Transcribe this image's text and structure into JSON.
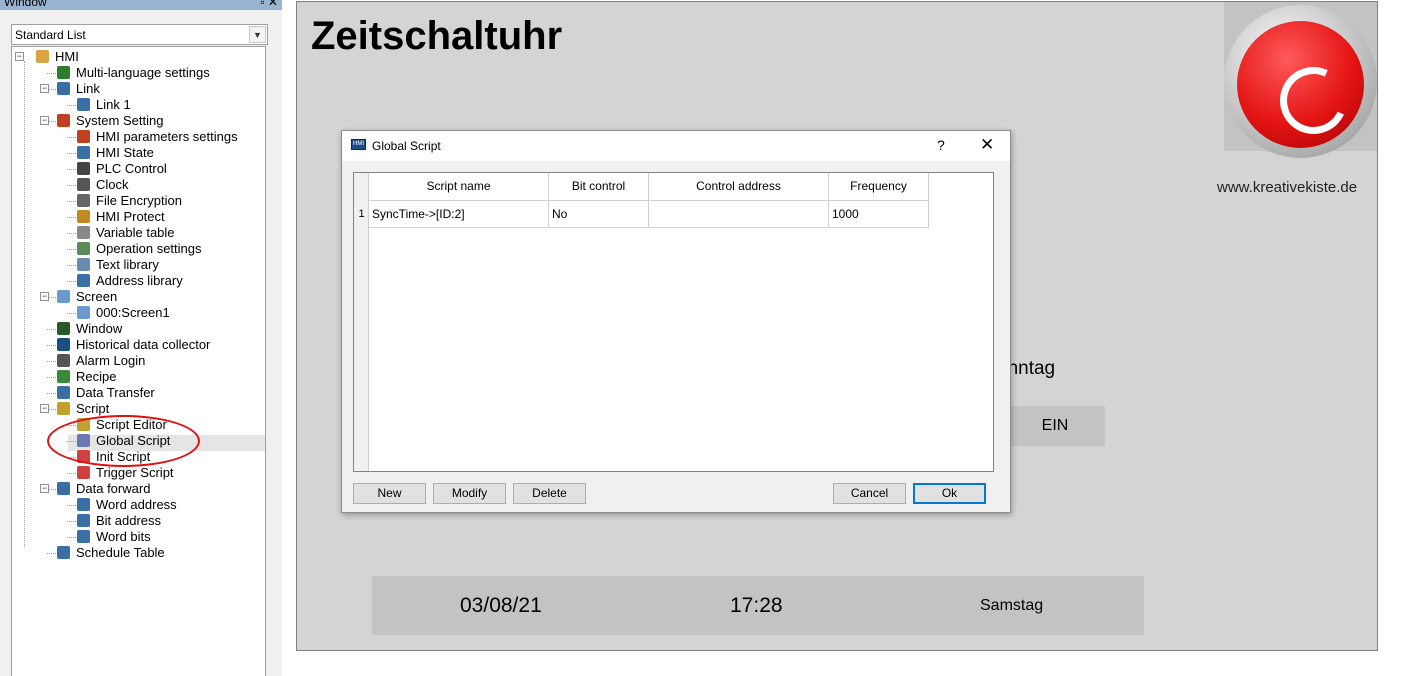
{
  "panel": {
    "title": "Window",
    "title_buttons": "▫ ✕",
    "list_type": "Standard List",
    "tree": [
      {
        "label": "HMI",
        "level": 0,
        "icon": "hmi-icon",
        "color": "#d9a441"
      },
      {
        "label": "Multi-language settings",
        "level": 1,
        "icon": "globe-icon",
        "color": "#2d7d2d"
      },
      {
        "label": "Link",
        "level": 1,
        "icon": "network-icon",
        "color": "#3a6ea5"
      },
      {
        "label": "Link 1",
        "level": 2,
        "icon": "network-node-icon",
        "color": "#3a6ea5"
      },
      {
        "label": "System Setting",
        "level": 1,
        "icon": "tools-icon",
        "color": "#c04020"
      },
      {
        "label": "HMI parameters settings",
        "level": 2,
        "icon": "settings-icon",
        "color": "#c04020"
      },
      {
        "label": "HMI State",
        "level": 2,
        "icon": "state-icon",
        "color": "#3a6ea5"
      },
      {
        "label": "PLC Control",
        "level": 2,
        "icon": "plc-icon",
        "color": "#444444"
      },
      {
        "label": "Clock",
        "level": 2,
        "icon": "clock-icon",
        "color": "#555555"
      },
      {
        "label": "File Encryption",
        "level": 2,
        "icon": "lock-icon",
        "color": "#666666"
      },
      {
        "label": "HMI Protect",
        "level": 2,
        "icon": "key-icon",
        "color": "#c08a20"
      },
      {
        "label": "Variable table",
        "level": 2,
        "icon": "table-icon",
        "color": "#888888"
      },
      {
        "label": "Operation settings",
        "level": 2,
        "icon": "operation-icon",
        "color": "#5a8a5a"
      },
      {
        "label": "Text library",
        "level": 2,
        "icon": "text-library-icon",
        "color": "#6a8ab0"
      },
      {
        "label": "Address library",
        "level": 2,
        "icon": "address-library-icon",
        "color": "#3a6ea5"
      },
      {
        "label": "Screen",
        "level": 1,
        "icon": "screen-icon",
        "color": "#6a9ad0"
      },
      {
        "label": "000:Screen1",
        "level": 2,
        "icon": "screen-page-icon",
        "color": "#6a9ad0"
      },
      {
        "label": "Window",
        "level": 1,
        "icon": "window-icon",
        "color": "#2a5a2a"
      },
      {
        "label": "Historical data collector",
        "level": 1,
        "icon": "save-icon",
        "color": "#1c4e86"
      },
      {
        "label": "Alarm Login",
        "level": 1,
        "icon": "alarm-icon",
        "color": "#555555"
      },
      {
        "label": "Recipe",
        "level": 1,
        "icon": "recipe-icon",
        "color": "#3a8a3a"
      },
      {
        "label": "Data Transfer",
        "level": 1,
        "icon": "data-transfer-icon",
        "color": "#3a6ea5"
      },
      {
        "label": "Script",
        "level": 1,
        "icon": "script-icon",
        "color": "#c0a030"
      },
      {
        "label": "Script Editor",
        "level": 2,
        "icon": "pencil-icon",
        "color": "#c0a030"
      },
      {
        "label": "Global Script",
        "level": 2,
        "icon": "global-script-icon",
        "color": "#6a7ab0"
      },
      {
        "label": "Init Script",
        "level": 2,
        "icon": "init-script-icon",
        "color": "#d04040"
      },
      {
        "label": "Trigger Script",
        "level": 2,
        "icon": "trigger-script-icon",
        "color": "#d04040"
      },
      {
        "label": "Data forward",
        "level": 1,
        "icon": "data-forward-icon",
        "color": "#3a6ea5"
      },
      {
        "label": "Word address",
        "level": 2,
        "icon": "word-address-icon",
        "color": "#3a6ea5"
      },
      {
        "label": "Bit address",
        "level": 2,
        "icon": "bit-address-icon",
        "color": "#3a6ea5"
      },
      {
        "label": "Word bits",
        "level": 2,
        "icon": "word-bits-icon",
        "color": "#3a6ea5"
      },
      {
        "label": "Schedule Table",
        "level": 1,
        "icon": "calendar-icon",
        "color": "#3a6ea5"
      }
    ]
  },
  "screen": {
    "title": "Zeitschaltuhr",
    "website": "www.kreativekiste.de",
    "day_label": "onntag",
    "switch_state": "EIN",
    "date": "03/08/21",
    "time": "17:28",
    "weekday": "Samstag"
  },
  "dialog": {
    "title": "Global Script",
    "icon_text": "HMI",
    "help": "?",
    "close": "✕",
    "columns": [
      "Script name",
      "Bit control",
      "Control address",
      "Frequency"
    ],
    "rows": [
      {
        "num": "1",
        "script_name": "SyncTime->[ID:2]",
        "bit_control": "No",
        "control_address": "",
        "frequency": "1000"
      }
    ],
    "buttons": {
      "new": "New",
      "modify": "Modify",
      "delete": "Delete",
      "cancel": "Cancel",
      "ok": "Ok"
    }
  }
}
